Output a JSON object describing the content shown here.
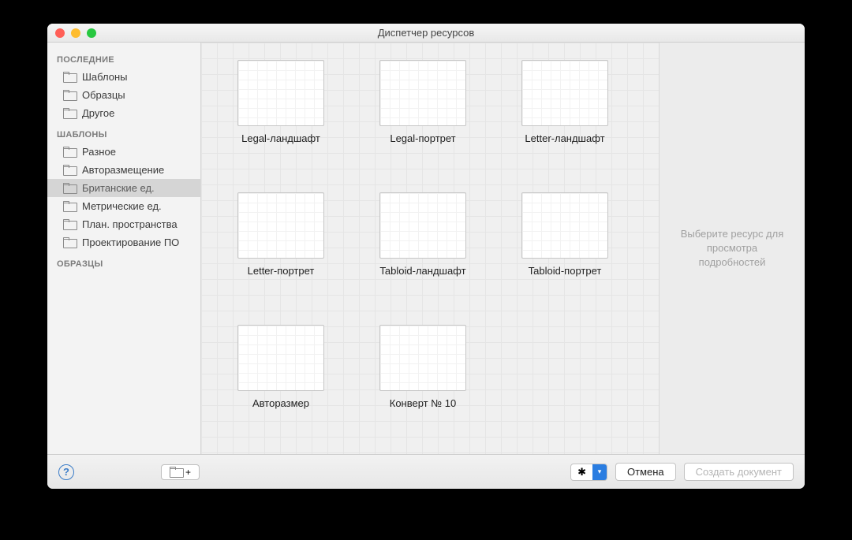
{
  "window": {
    "title": "Диспетчер ресурсов"
  },
  "sidebar": {
    "sections": [
      {
        "header": "ПОСЛЕДНИЕ",
        "items": [
          {
            "label": "Шаблоны",
            "selected": false
          },
          {
            "label": "Образцы",
            "selected": false
          },
          {
            "label": "Другое",
            "selected": false
          }
        ]
      },
      {
        "header": "ШАБЛОНЫ",
        "items": [
          {
            "label": "Разное",
            "selected": false
          },
          {
            "label": "Авторазмещение",
            "selected": false
          },
          {
            "label": "Британские ед.",
            "selected": true
          },
          {
            "label": "Метрические ед.",
            "selected": false
          },
          {
            "label": "План. пространства",
            "selected": false
          },
          {
            "label": "Проектирование ПО",
            "selected": false
          }
        ]
      },
      {
        "header": "ОБРАЗЦЫ",
        "items": []
      }
    ]
  },
  "templates": [
    {
      "label": "Legal-ландшафт"
    },
    {
      "label": "Legal-портрет"
    },
    {
      "label": "Letter-ландшафт"
    },
    {
      "label": "Letter-портрет"
    },
    {
      "label": "Tabloid-ландшафт"
    },
    {
      "label": "Tabloid-портрет"
    },
    {
      "label": "Авторазмер"
    },
    {
      "label": "Конверт № 10"
    }
  ],
  "details": {
    "placeholder": "Выберите ресурс для просмотра подробностей"
  },
  "footer": {
    "help": "?",
    "add_label": "+",
    "gear": "✱",
    "cancel": "Отмена",
    "create": "Создать документ"
  }
}
